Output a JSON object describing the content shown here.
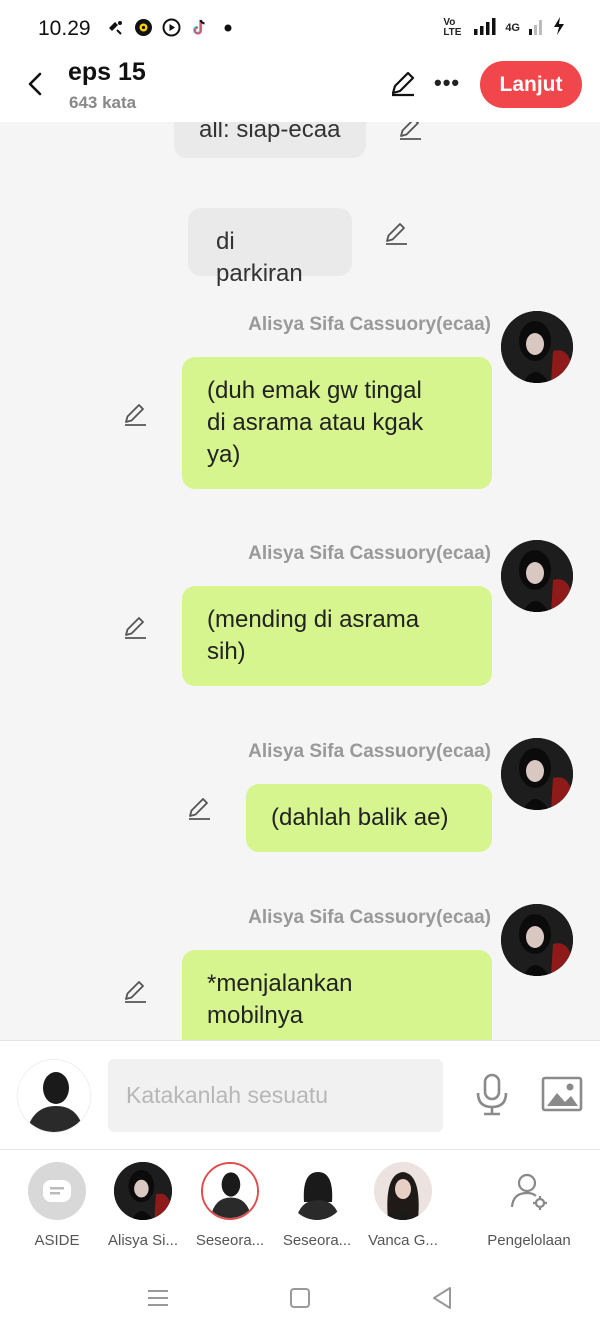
{
  "status_bar": {
    "time": "10.29",
    "network_badge": "Vo LTE",
    "network_gen": "4G"
  },
  "header": {
    "title": "eps 15",
    "subtitle": "643 kata",
    "next_label": "Lanjut"
  },
  "messages": [
    {
      "type": "narration",
      "text": "all: siap-ecaa"
    },
    {
      "type": "narration",
      "text": "di parkiran"
    },
    {
      "type": "character",
      "sender": "Alisya Sifa Cassuory(ecaa)",
      "lines": [
        "(duh emak gw tingal",
        "di asrama atau kgak",
        "ya)"
      ]
    },
    {
      "type": "character",
      "sender": "Alisya Sifa Cassuory(ecaa)",
      "lines": [
        "(mending di asrama",
        "sih)"
      ]
    },
    {
      "type": "character",
      "sender": "Alisya Sifa Cassuory(ecaa)",
      "lines": [
        "(dahlah balik ae)"
      ]
    },
    {
      "type": "character",
      "sender": "Alisya Sifa Cassuory(ecaa)",
      "lines": [
        "*menjalankan",
        "mobilnya"
      ]
    }
  ],
  "composer": {
    "placeholder": "Katakanlah sesuatu"
  },
  "characters": [
    {
      "label": "ASIDE"
    },
    {
      "label": "Alisya Si..."
    },
    {
      "label": "Seseora..."
    },
    {
      "label": "Seseora..."
    },
    {
      "label": "Vanca G..."
    },
    {
      "label": "Pengelolaan"
    }
  ],
  "colors": {
    "accent": "#f0464c",
    "bubble_green": "#d6f58e",
    "bubble_gray": "#eaeaea",
    "sender_gray": "#999999"
  }
}
